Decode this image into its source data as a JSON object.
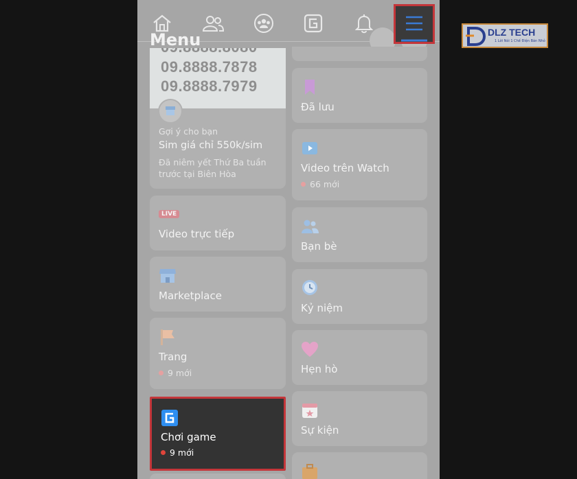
{
  "menu_title": "Menu",
  "nav": [
    "home-icon",
    "friends-icon",
    "groups-icon",
    "gaming-icon",
    "bell-icon"
  ],
  "sim_ad": {
    "lines": [
      "09.8888.8080",
      "09.8888.7878",
      "09.8888.7979"
    ],
    "suggest": "Gợi ý cho bạn",
    "title": "Sim giá chỉ 550k/sim",
    "desc1": "Đã niêm yết Thứ Ba tuần",
    "desc2": "trước tại Biên Hòa"
  },
  "left_items": {
    "live_badge": "LIVE",
    "live": "Video trực tiếp",
    "marketplace": "Marketplace",
    "pages": "Trang",
    "pages_new": "9 mới",
    "gaming": "Chơi game",
    "gaming_new": "9 mới"
  },
  "right_items": {
    "saved": "Đã lưu",
    "watch": "Video trên Watch",
    "watch_new": "66 mới",
    "friends": "Bạn bè",
    "memories": "Kỷ niệm",
    "dating": "Hẹn hò",
    "events": "Sự kiện"
  },
  "logo": {
    "text": "DLZ TECH",
    "tagline": "1 Lời Nói 1 Chế Điện Bán Nhỏ"
  },
  "colors": {
    "highlight": "#c4363a",
    "menu_icon": "#3a7bd5",
    "notif_dot": "#e6a0a0"
  }
}
